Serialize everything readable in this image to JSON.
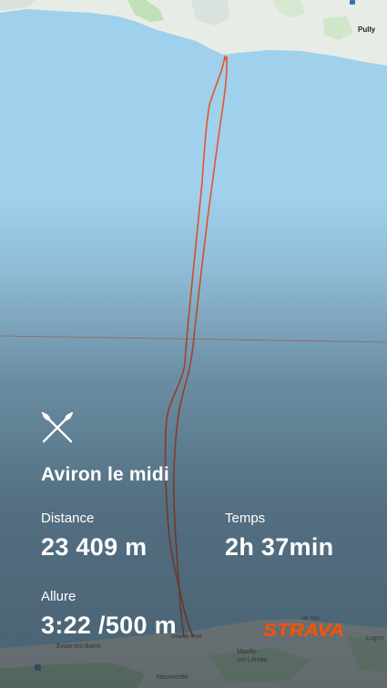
{
  "map": {
    "places": {
      "pully": "Pully",
      "evian": "Évian-les-Bains",
      "grande_rive": "Grande Rive",
      "maxilly": "Maxilly-\nsur-Léman",
      "neuvecelle": "Neuvecelle",
      "lugrin": "Lugrin",
      "near_lugrin": "de Ney"
    },
    "colors": {
      "lake": "#9fd0ec",
      "land": "#e8ece7",
      "park": "#bfe0b9",
      "route": "#e2562a"
    }
  },
  "activity": {
    "sport_icon": "rowing-oars-icon",
    "title": "Aviron le midi"
  },
  "stats": {
    "distance_label": "Distance",
    "distance_value": "23 409 m",
    "time_label": "Temps",
    "time_value": "2h 37min",
    "pace_label": "Allure",
    "pace_value": "3:22 /500 m"
  },
  "brand": {
    "logo_text": "STRAVA",
    "color": "#fc5200"
  }
}
